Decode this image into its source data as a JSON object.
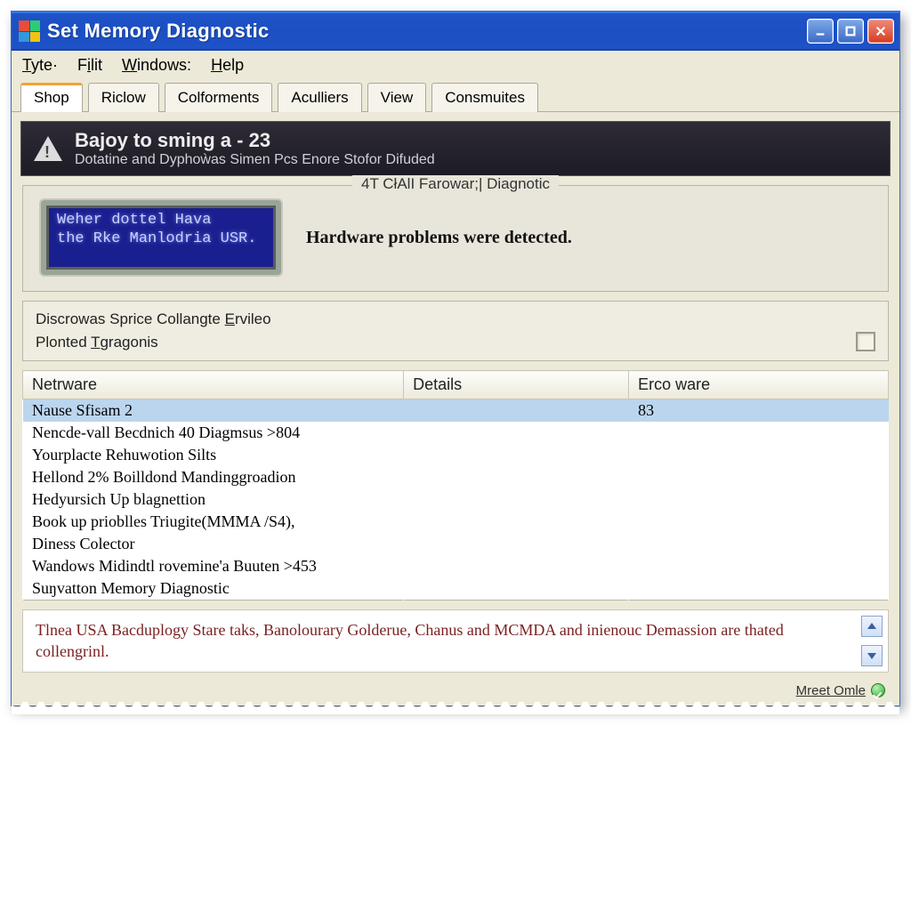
{
  "window": {
    "title": "Set Memory Diagnostic"
  },
  "menubar": [
    "Tyte·",
    "Filit",
    "Windows:",
    "Help"
  ],
  "tabs": [
    "Shop",
    "Riclow",
    "Colforments",
    "Aculliers",
    "View",
    "Consmuites"
  ],
  "banner": {
    "title": "Bajoy to sming a - 23",
    "subtitle": "Dotatine and Dyphoẁas Simen Pcs Enore Stofor Difuded"
  },
  "diagnostic": {
    "legend": "4T CłAlI Farowar;| Diagnotic",
    "lcd_line1": "Weher dottel Hava",
    "lcd_line2": "the Rke Manlodria USR.",
    "message": "Hardware problems were detected."
  },
  "subpanel": {
    "line1_a": "Discrowas Sprice Collangte ",
    "line1_b": "E",
    "line1_c": "rvileo",
    "line2_a": "Plonted ",
    "line2_b": "T",
    "line2_c": "gragonis"
  },
  "table": {
    "headers": [
      "Netrware",
      "Details",
      "Erco ware"
    ],
    "rows": [
      {
        "c0": "Nause Sfisam 2",
        "c1": "",
        "c2": "83",
        "selected": true
      },
      {
        "c0": "Nencde-vall Becdnich 40 Diagmsus >804",
        "c1": "",
        "c2": ""
      },
      {
        "c0": "Yourplacte Rehuwotion Silts",
        "c1": "",
        "c2": ""
      },
      {
        "c0": "Hellond 2% Boilldond Mandinggroadion",
        "c1": "",
        "c2": ""
      },
      {
        "c0": "Hedyursich Up blagnettion",
        "c1": "",
        "c2": ""
      },
      {
        "c0": "Book up prioblles Triugite(MMMA /S4),",
        "c1": "",
        "c2": ""
      },
      {
        "c0": "Diness Colector",
        "c1": "",
        "c2": ""
      },
      {
        "c0": "Wandows Midindtl rovemine'a Buuten >453",
        "c1": "",
        "c2": ""
      },
      {
        "c0": "Suŋvatton Memory Diagnostic",
        "c1": "",
        "c2": ""
      }
    ]
  },
  "footnote": "Tlnea USA Bacduplogy Stare taks, Banolourary Golderue, Chanus and MCMDA and inienouc Demassion are thated collengrinl.",
  "statusbar": {
    "text": "Mreet Omle"
  }
}
